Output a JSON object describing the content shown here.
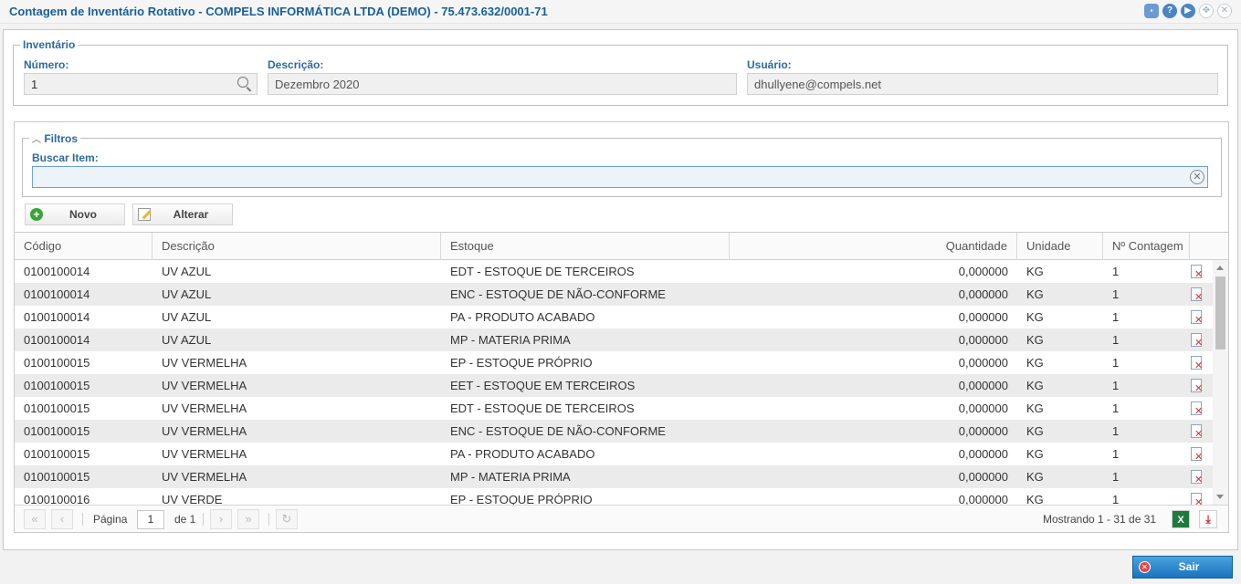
{
  "window": {
    "title": "Contagem de Inventário Rotativo - COMPELS INFORMÁTICA LTDA (DEMO) - 75.473.632/0001-71"
  },
  "inventario": {
    "legend": "Inventário",
    "numero_label": "Número:",
    "numero_value": "1",
    "descricao_label": "Descrição:",
    "descricao_value": "Dezembro 2020",
    "usuario_label": "Usuário:",
    "usuario_value": "dhullyene@compels.net"
  },
  "filtros": {
    "legend": "Filtros",
    "buscar_label": "Buscar Item:",
    "buscar_value": ""
  },
  "toolbar": {
    "novo_label": "Novo",
    "alterar_label": "Alterar"
  },
  "grid": {
    "columns": [
      "Código",
      "Descrição",
      "Estoque",
      "Quantidade",
      "Unidade",
      "Nº Contagem"
    ],
    "rows": [
      [
        "0100100014",
        "UV AZUL",
        "EDT - ESTOQUE DE TERCEIROS",
        "0,000000",
        "KG",
        "1"
      ],
      [
        "0100100014",
        "UV AZUL",
        "ENC - ESTOQUE DE NÃO-CONFORME",
        "0,000000",
        "KG",
        "1"
      ],
      [
        "0100100014",
        "UV AZUL",
        "PA - PRODUTO ACABADO",
        "0,000000",
        "KG",
        "1"
      ],
      [
        "0100100014",
        "UV AZUL",
        "MP - MATERIA PRIMA",
        "0,000000",
        "KG",
        "1"
      ],
      [
        "0100100015",
        "UV VERMELHA",
        "EP - ESTOQUE PRÓPRIO",
        "0,000000",
        "KG",
        "1"
      ],
      [
        "0100100015",
        "UV VERMELHA",
        "EET - ESTOQUE EM TERCEIROS",
        "0,000000",
        "KG",
        "1"
      ],
      [
        "0100100015",
        "UV VERMELHA",
        "EDT - ESTOQUE DE TERCEIROS",
        "0,000000",
        "KG",
        "1"
      ],
      [
        "0100100015",
        "UV VERMELHA",
        "ENC - ESTOQUE DE NÃO-CONFORME",
        "0,000000",
        "KG",
        "1"
      ],
      [
        "0100100015",
        "UV VERMELHA",
        "PA - PRODUTO ACABADO",
        "0,000000",
        "KG",
        "1"
      ],
      [
        "0100100015",
        "UV VERMELHA",
        "MP - MATERIA PRIMA",
        "0,000000",
        "KG",
        "1"
      ],
      [
        "0100100016",
        "UV VERDE",
        "EP - ESTOQUE PRÓPRIO",
        "0,000000",
        "KG",
        "1"
      ]
    ]
  },
  "pager": {
    "pagina_label": "Página",
    "pagina_value": "1",
    "de_label": "de 1",
    "mostrando": "Mostrando 1 - 31 de 31"
  },
  "footer": {
    "sair_label": "Sair"
  },
  "icons": {
    "row_action": "pdf-delete-icon"
  },
  "colors": {
    "title": "#1a5f96",
    "label": "#2d6a9f",
    "sair_button": "#1a73bd",
    "row_alt": "#ebebeb"
  }
}
